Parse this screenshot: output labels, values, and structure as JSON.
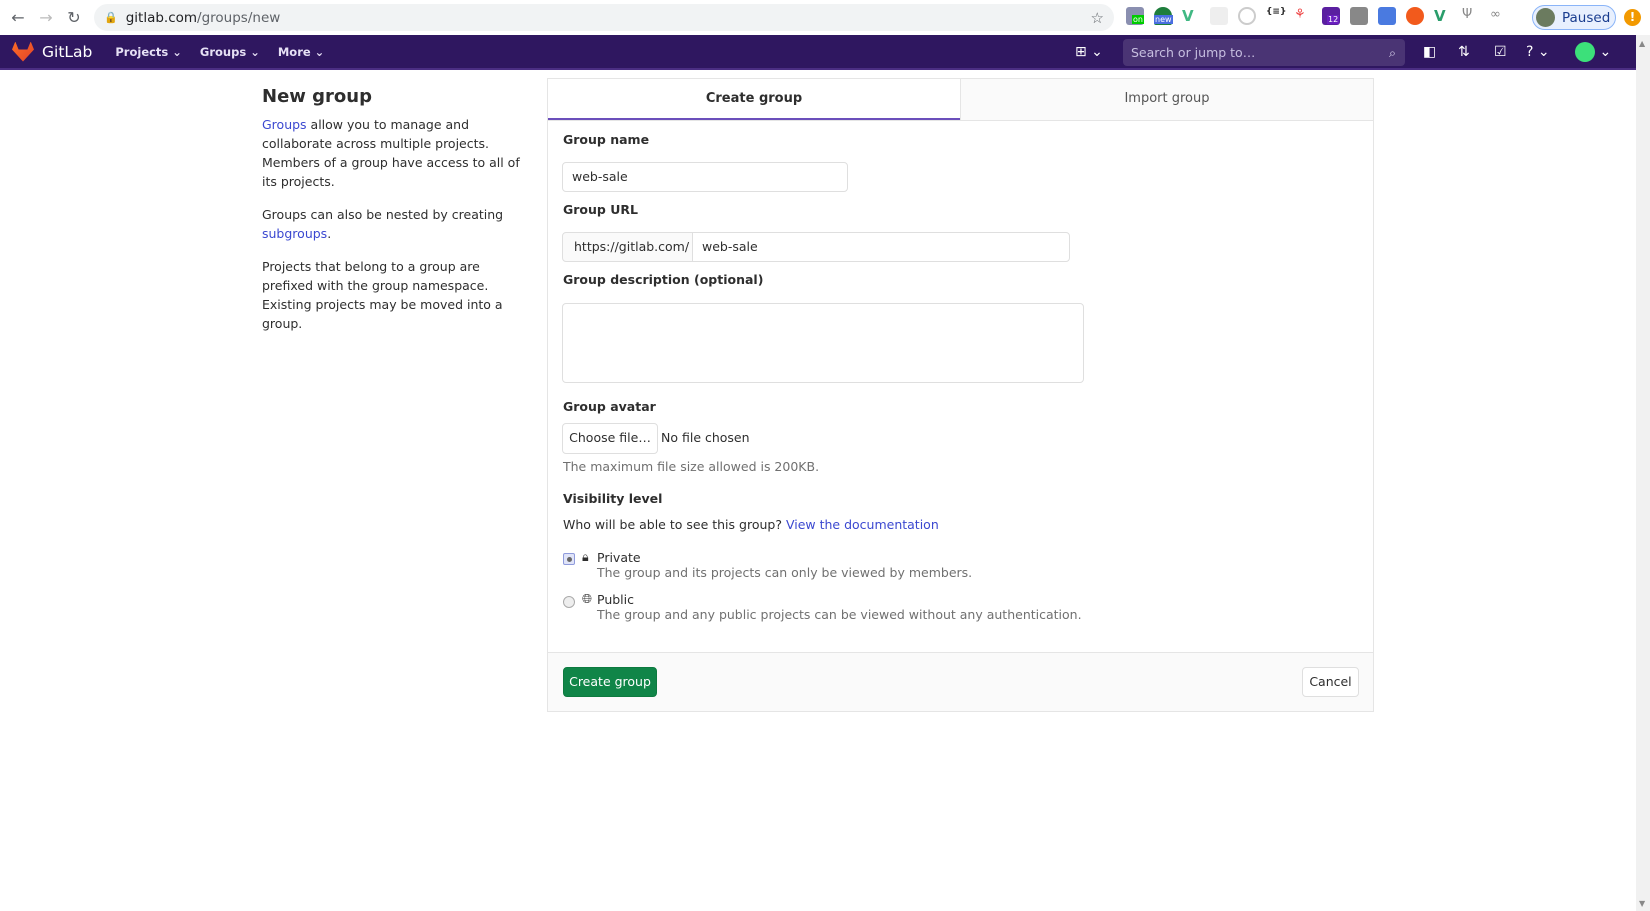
{
  "browser": {
    "url_host": "gitlab.com",
    "url_path": "/groups/new",
    "profile_label": "Paused",
    "ext_badges": [
      "on",
      "new",
      "12"
    ]
  },
  "nav": {
    "brand": "GitLab",
    "menus": [
      "Projects",
      "Groups",
      "More"
    ],
    "search_placeholder": "Search or jump to…"
  },
  "sidebar": {
    "title": "New group",
    "p1_link": "Groups",
    "p1_rest": " allow you to manage and collaborate across multiple projects. Members of a group have access to all of its projects.",
    "p2_text": "Groups can also be nested by creating ",
    "p2_link": "subgroups",
    "p2_end": ".",
    "p3": "Projects that belong to a group are prefixed with the group namespace. Existing projects may be moved into a group."
  },
  "tabs": [
    {
      "label": "Create group",
      "active": true
    },
    {
      "label": "Import group",
      "active": false
    }
  ],
  "form": {
    "group_name_label": "Group name",
    "group_name_value": "web-sale",
    "group_url_label": "Group URL",
    "url_prefix": "https://gitlab.com/",
    "url_value": "web-sale",
    "description_label": "Group description (optional)",
    "description_value": "",
    "avatar_label": "Group avatar",
    "choose_file": "Choose file…",
    "no_file": "No file chosen",
    "avatar_help": "The maximum file size allowed is 200KB.",
    "visibility_label": "Visibility level",
    "visibility_question": "Who will be able to see this group?",
    "visibility_link": "View the documentation",
    "options": [
      {
        "label": "Private",
        "desc": "The group and its projects can only be viewed by members.",
        "checked": true
      },
      {
        "label": "Public",
        "desc": "The group and any public projects can be viewed without any authentication.",
        "checked": false
      }
    ]
  },
  "footer": {
    "submit": "Create group",
    "cancel": "Cancel"
  }
}
